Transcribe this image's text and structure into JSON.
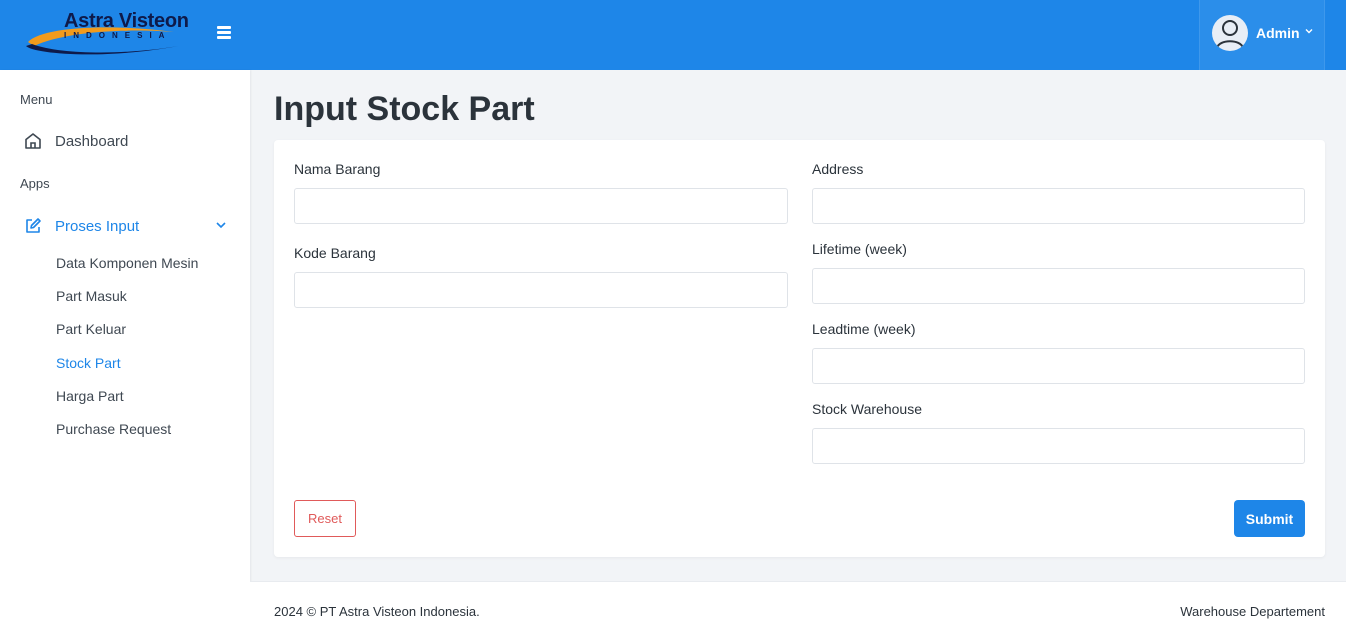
{
  "brand": {
    "name": "Astra Visteon",
    "sub": "INDONESIA"
  },
  "topbar": {
    "user_name": "Admin",
    "user_caret": "⌄"
  },
  "sidebar": {
    "menu_heading": "Menu",
    "dashboard_label": "Dashboard",
    "apps_heading": "Apps",
    "proses_input_label": "Proses Input",
    "sub_items": [
      {
        "label": "Data Komponen Mesin"
      },
      {
        "label": "Part Masuk"
      },
      {
        "label": "Part Keluar"
      },
      {
        "label": "Stock Part",
        "active": true
      },
      {
        "label": "Harga Part"
      },
      {
        "label": "Purchase Request"
      }
    ]
  },
  "main": {
    "title": "Input Stock Part",
    "form": {
      "nama_barang": {
        "label": "Nama Barang",
        "value": ""
      },
      "kode_barang": {
        "label": "Kode Barang",
        "value": ""
      },
      "address": {
        "label": "Address",
        "value": ""
      },
      "lifetime": {
        "label": "Lifetime (week)",
        "value": ""
      },
      "leadtime": {
        "label": "Leadtime (week)",
        "value": ""
      },
      "stock_warehouse": {
        "label": "Stock Warehouse",
        "value": ""
      }
    },
    "reset_label": "Reset",
    "submit_label": "Submit"
  },
  "footer": {
    "copyright": "2024 © PT Astra Visteon Indonesia.",
    "department": "Warehouse Departement"
  },
  "colors": {
    "primary": "#1e86e8",
    "danger": "#e05a5a",
    "background": "#f2f4f7"
  }
}
